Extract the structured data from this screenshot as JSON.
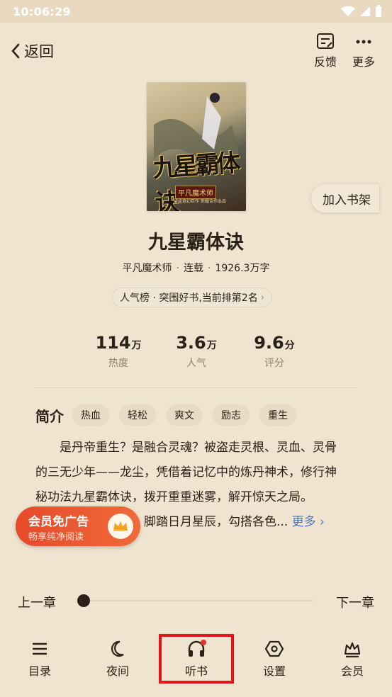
{
  "status_bar": {
    "time": "10:06:29"
  },
  "nav": {
    "back_label": "返回",
    "feedback_label": "反馈",
    "more_label": "更多"
  },
  "book": {
    "cover": {
      "title_art": "九星霸体诀",
      "author_art": "平凡魔术师",
      "subtitle_art": "最佳奇幻巨作 荣耀合作出品"
    },
    "add_shelf_label": "加入书架",
    "title": "九星霸体诀",
    "author": "平凡魔术师",
    "status": "连载",
    "word_count": "1926.3万字",
    "rank_text": "人气榜 · 突围好书,当前排第2名",
    "stats": [
      {
        "value": "114",
        "unit": "万",
        "label": "热度"
      },
      {
        "value": "3.6",
        "unit": "万",
        "label": "人气"
      },
      {
        "value": "9.6",
        "unit": "分",
        "label": "评分"
      }
    ],
    "intro_title": "简介",
    "tags": [
      "热血",
      "轻松",
      "爽文",
      "励志",
      "重生"
    ],
    "intro_lines": [
      "　　是丹帝重生？是融合灵魂？被盗走灵根、灵血、灵骨",
      "的三无少年——龙尘，凭借着记忆中的炼丹神术，修行神",
      "秘功法九星霸体诀，拨开重重迷雾，解开惊天之局。",
      "　　　　　　　　，脚踏日月星辰，勾搭各色..."
    ],
    "more_label": "更多 ›"
  },
  "vip_promo": {
    "title": "会员免广告",
    "subtitle": "畅享纯净阅读"
  },
  "reader_controls": {
    "prev_chapter": "上一章",
    "next_chapter": "下一章",
    "progress": 0.0
  },
  "tabbar": {
    "items": [
      {
        "label": "目录",
        "icon": "menu-icon"
      },
      {
        "label": "夜间",
        "icon": "moon-icon"
      },
      {
        "label": "听书",
        "icon": "headphones-icon"
      },
      {
        "label": "设置",
        "icon": "settings-hexagon-icon"
      },
      {
        "label": "会员",
        "icon": "crown-icon"
      }
    ]
  },
  "colors": {
    "background": "#efe4d0",
    "accent_red": "#e5141a",
    "vip_orange": "#e64a2a",
    "link_blue": "#4a72c8"
  }
}
